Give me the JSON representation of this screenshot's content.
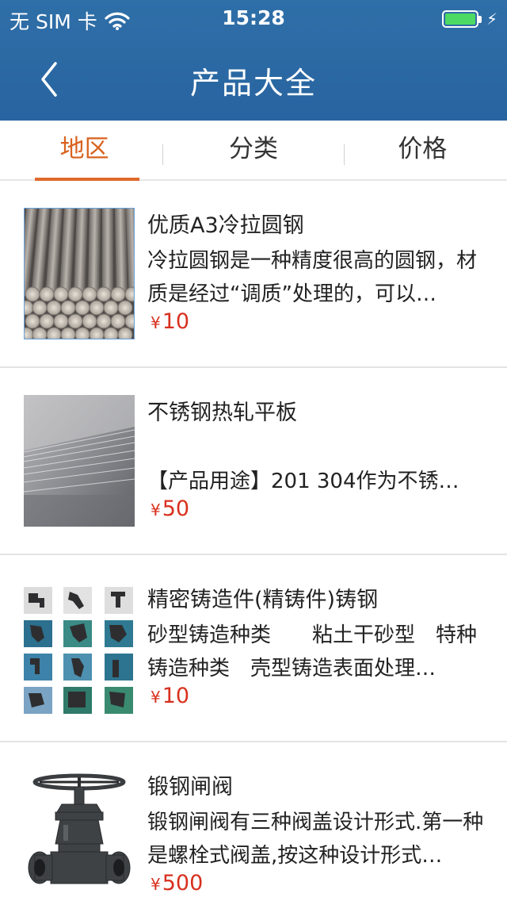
{
  "status_bar": {
    "carrier": "无 SIM 卡",
    "time": "15:28",
    "battery_level": 1.0
  },
  "navbar": {
    "title": "产品大全",
    "back_icon": "chevron-left-icon"
  },
  "tabs": [
    {
      "label": "地区",
      "active": true
    },
    {
      "label": "分类",
      "active": false
    },
    {
      "label": "价格",
      "active": false
    }
  ],
  "colors": {
    "header": "#2a67a2",
    "tab_active": "#d8621f",
    "price": "#d8301e"
  },
  "products": [
    {
      "title": "优质A3冷拉圆钢",
      "description": "冷拉圆钢是一种精度很高的圆钢，材质是经过“调质”处理的，可以…",
      "currency": "¥",
      "price": "10",
      "image": "steel-round-bars-photo"
    },
    {
      "title": "不锈钢热轧平板",
      "description": "【产品用途】201 304作为不锈…",
      "currency": "¥",
      "price": "50",
      "image": "steel-plate-stack-photo"
    },
    {
      "title": "精密铸造件(精铸件)铸钢",
      "description": "砂型铸造种类　　粘土干砂型　特种铸造种类　壳型铸造表面处理…",
      "currency": "¥",
      "price": "10",
      "image": "castings-grid-photo"
    },
    {
      "title": "锻钢闸阀",
      "description": "锻钢闸阀有三种阀盖设计形式.第一种是螺栓式阀盖,按这种设计形式…",
      "currency": "¥",
      "price": "500",
      "image": "gate-valve-photo"
    }
  ]
}
